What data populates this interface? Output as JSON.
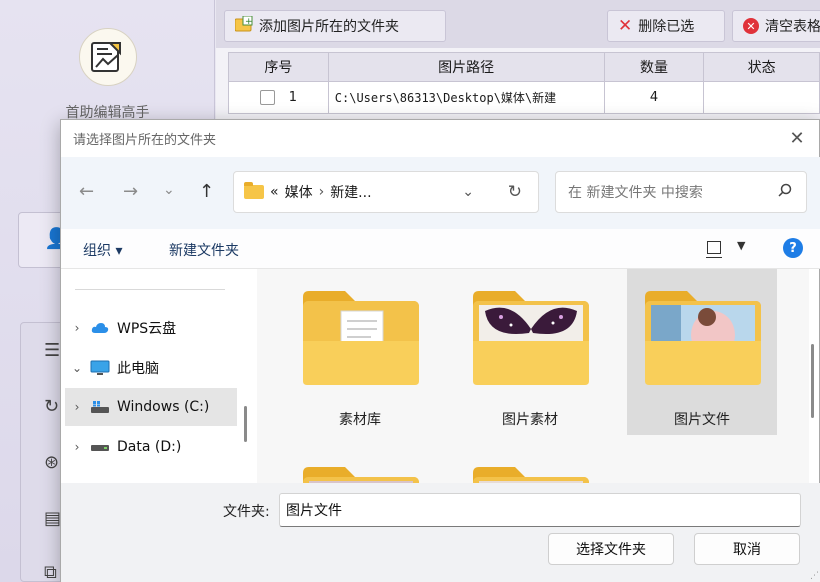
{
  "app": {
    "name": "首助编辑高手",
    "toolbar": {
      "add_folder": "添加图片所在的文件夹",
      "delete_selected": "删除已选",
      "clear_table": "清空表格"
    },
    "table": {
      "columns": [
        "序号",
        "图片路径",
        "数量",
        "状态"
      ],
      "rows": [
        {
          "index": "1",
          "path": "C:\\Users\\86313\\Desktop\\媒体\\新建",
          "count": "4",
          "status": ""
        }
      ]
    }
  },
  "dialog": {
    "title": "请选择图片所在的文件夹",
    "breadcrumb": {
      "prefix": "«",
      "parts": [
        "媒体",
        "新建..."
      ]
    },
    "search_placeholder": "在 新建文件夹 中搜索",
    "commands": {
      "organize": "组织 ▾",
      "new_folder": "新建文件夹"
    },
    "nav": [
      {
        "label": "WPS云盘",
        "expander": "›",
        "icon": "cloud-icon"
      },
      {
        "label": "此电脑",
        "expander": "⌄",
        "icon": "computer-icon"
      },
      {
        "label": "Windows (C:)",
        "expander": "›",
        "icon": "drive-icon",
        "selected": true
      },
      {
        "label": "Data (D:)",
        "expander": "›",
        "icon": "drive-icon"
      }
    ],
    "folders": [
      {
        "name": "素材库",
        "thumb": "document"
      },
      {
        "name": "图片素材",
        "thumb": "butterfly"
      },
      {
        "name": "图片文件",
        "thumb": "photo",
        "selected": true
      },
      {
        "name": "",
        "thumb": "photo"
      },
      {
        "name": "",
        "thumb": "photo"
      }
    ],
    "folder_field_label": "文件夹:",
    "folder_field_value": "图片文件",
    "buttons": {
      "select": "选择文件夹",
      "cancel": "取消"
    }
  },
  "colors": {
    "accent": "#1e7de6",
    "folder_yellow": "#f6c547",
    "danger": "#e0323a"
  }
}
